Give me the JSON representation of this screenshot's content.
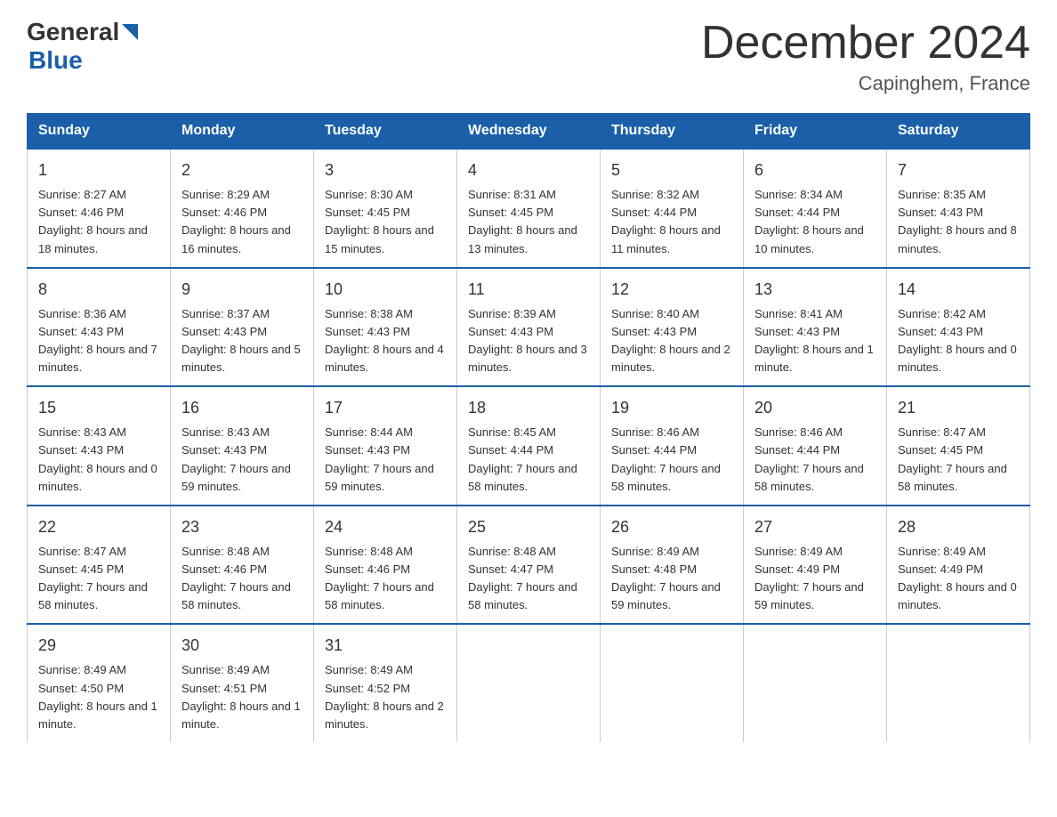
{
  "header": {
    "logo_general": "General",
    "logo_blue": "Blue",
    "title": "December 2024",
    "location": "Capinghem, France"
  },
  "days_of_week": [
    "Sunday",
    "Monday",
    "Tuesday",
    "Wednesday",
    "Thursday",
    "Friday",
    "Saturday"
  ],
  "weeks": [
    {
      "days": [
        {
          "num": "1",
          "sunrise": "8:27 AM",
          "sunset": "4:46 PM",
          "daylight": "8 hours and 18 minutes."
        },
        {
          "num": "2",
          "sunrise": "8:29 AM",
          "sunset": "4:46 PM",
          "daylight": "8 hours and 16 minutes."
        },
        {
          "num": "3",
          "sunrise": "8:30 AM",
          "sunset": "4:45 PM",
          "daylight": "8 hours and 15 minutes."
        },
        {
          "num": "4",
          "sunrise": "8:31 AM",
          "sunset": "4:45 PM",
          "daylight": "8 hours and 13 minutes."
        },
        {
          "num": "5",
          "sunrise": "8:32 AM",
          "sunset": "4:44 PM",
          "daylight": "8 hours and 11 minutes."
        },
        {
          "num": "6",
          "sunrise": "8:34 AM",
          "sunset": "4:44 PM",
          "daylight": "8 hours and 10 minutes."
        },
        {
          "num": "7",
          "sunrise": "8:35 AM",
          "sunset": "4:43 PM",
          "daylight": "8 hours and 8 minutes."
        }
      ]
    },
    {
      "days": [
        {
          "num": "8",
          "sunrise": "8:36 AM",
          "sunset": "4:43 PM",
          "daylight": "8 hours and 7 minutes."
        },
        {
          "num": "9",
          "sunrise": "8:37 AM",
          "sunset": "4:43 PM",
          "daylight": "8 hours and 5 minutes."
        },
        {
          "num": "10",
          "sunrise": "8:38 AM",
          "sunset": "4:43 PM",
          "daylight": "8 hours and 4 minutes."
        },
        {
          "num": "11",
          "sunrise": "8:39 AM",
          "sunset": "4:43 PM",
          "daylight": "8 hours and 3 minutes."
        },
        {
          "num": "12",
          "sunrise": "8:40 AM",
          "sunset": "4:43 PM",
          "daylight": "8 hours and 2 minutes."
        },
        {
          "num": "13",
          "sunrise": "8:41 AM",
          "sunset": "4:43 PM",
          "daylight": "8 hours and 1 minute."
        },
        {
          "num": "14",
          "sunrise": "8:42 AM",
          "sunset": "4:43 PM",
          "daylight": "8 hours and 0 minutes."
        }
      ]
    },
    {
      "days": [
        {
          "num": "15",
          "sunrise": "8:43 AM",
          "sunset": "4:43 PM",
          "daylight": "8 hours and 0 minutes."
        },
        {
          "num": "16",
          "sunrise": "8:43 AM",
          "sunset": "4:43 PM",
          "daylight": "7 hours and 59 minutes."
        },
        {
          "num": "17",
          "sunrise": "8:44 AM",
          "sunset": "4:43 PM",
          "daylight": "7 hours and 59 minutes."
        },
        {
          "num": "18",
          "sunrise": "8:45 AM",
          "sunset": "4:44 PM",
          "daylight": "7 hours and 58 minutes."
        },
        {
          "num": "19",
          "sunrise": "8:46 AM",
          "sunset": "4:44 PM",
          "daylight": "7 hours and 58 minutes."
        },
        {
          "num": "20",
          "sunrise": "8:46 AM",
          "sunset": "4:44 PM",
          "daylight": "7 hours and 58 minutes."
        },
        {
          "num": "21",
          "sunrise": "8:47 AM",
          "sunset": "4:45 PM",
          "daylight": "7 hours and 58 minutes."
        }
      ]
    },
    {
      "days": [
        {
          "num": "22",
          "sunrise": "8:47 AM",
          "sunset": "4:45 PM",
          "daylight": "7 hours and 58 minutes."
        },
        {
          "num": "23",
          "sunrise": "8:48 AM",
          "sunset": "4:46 PM",
          "daylight": "7 hours and 58 minutes."
        },
        {
          "num": "24",
          "sunrise": "8:48 AM",
          "sunset": "4:46 PM",
          "daylight": "7 hours and 58 minutes."
        },
        {
          "num": "25",
          "sunrise": "8:48 AM",
          "sunset": "4:47 PM",
          "daylight": "7 hours and 58 minutes."
        },
        {
          "num": "26",
          "sunrise": "8:49 AM",
          "sunset": "4:48 PM",
          "daylight": "7 hours and 59 minutes."
        },
        {
          "num": "27",
          "sunrise": "8:49 AM",
          "sunset": "4:49 PM",
          "daylight": "7 hours and 59 minutes."
        },
        {
          "num": "28",
          "sunrise": "8:49 AM",
          "sunset": "4:49 PM",
          "daylight": "8 hours and 0 minutes."
        }
      ]
    },
    {
      "days": [
        {
          "num": "29",
          "sunrise": "8:49 AM",
          "sunset": "4:50 PM",
          "daylight": "8 hours and 1 minute."
        },
        {
          "num": "30",
          "sunrise": "8:49 AM",
          "sunset": "4:51 PM",
          "daylight": "8 hours and 1 minute."
        },
        {
          "num": "31",
          "sunrise": "8:49 AM",
          "sunset": "4:52 PM",
          "daylight": "8 hours and 2 minutes."
        },
        null,
        null,
        null,
        null
      ]
    }
  ],
  "labels": {
    "sunrise_prefix": "Sunrise: ",
    "sunset_prefix": "Sunset: ",
    "daylight_prefix": "Daylight: "
  },
  "colors": {
    "header_bg": "#1a5fa8",
    "header_text": "#ffffff",
    "border_color": "#1a5fa8",
    "text_color": "#333333",
    "logo_blue": "#1a5fa8"
  }
}
